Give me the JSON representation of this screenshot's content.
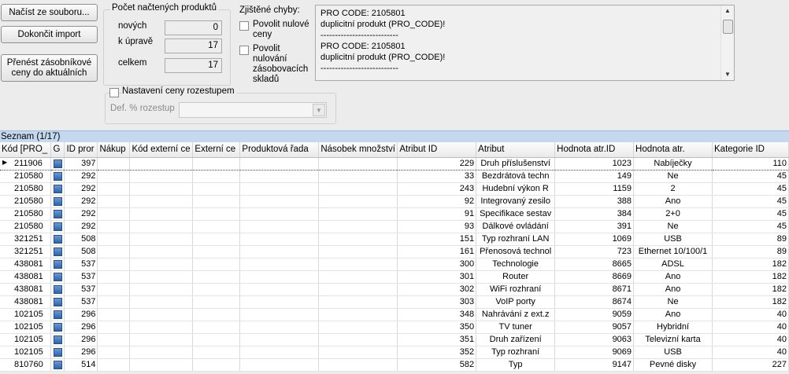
{
  "buttons": {
    "load": "Načíst ze souboru...",
    "finish": "Dokončit import",
    "transfer": "Přenést zásobníkové ceny do aktuálních"
  },
  "counts": {
    "title": "Počet načtených produktů",
    "new_label": "nových",
    "new_value": "0",
    "edit_label": "k úpravě",
    "edit_value": "17",
    "total_label": "celkem",
    "total_value": "17"
  },
  "errors": {
    "title": "Zjištěné chyby:",
    "allow_zero_prices": "Povolit nulové ceny",
    "allow_zero_stock": "Povolit nulování zásobovacích skladů",
    "text": "PRO CODE: 2105801\nduplicitní produkt (PRO_CODE)!\n---------------------------\nPRO CODE: 2105801\nduplicitní produkt (PRO_CODE)!\n---------------------------"
  },
  "step_pricing": {
    "label": "Nastavení ceny rozestupem",
    "def_label": "Def. % rozestup",
    "def_value": ""
  },
  "grid": {
    "title": "Seznam (1/17)",
    "columns": [
      "Kód [PRO_",
      "G",
      "ID pror",
      "Nákup",
      "Kód externí ce",
      "Externí ce",
      "Produktová řada",
      "Násobek množství",
      "Atribut ID",
      "Atribut",
      "Hodnota atr.ID",
      "Hodnota atr.",
      "Kategorie ID"
    ],
    "rows": [
      [
        "211906",
        "397",
        "",
        "",
        "",
        "",
        "",
        "229",
        "Druh příslušenství",
        "1023",
        "Nabíječky",
        "110"
      ],
      [
        "210580",
        "292",
        "",
        "",
        "",
        "",
        "",
        "33",
        "Bezdrátová techn",
        "149",
        "Ne",
        "45"
      ],
      [
        "210580",
        "292",
        "",
        "",
        "",
        "",
        "",
        "243",
        "Hudební výkon R",
        "1159",
        "2",
        "45"
      ],
      [
        "210580",
        "292",
        "",
        "",
        "",
        "",
        "",
        "92",
        "Integrovaný zesilo",
        "388",
        "Ano",
        "45"
      ],
      [
        "210580",
        "292",
        "",
        "",
        "",
        "",
        "",
        "91",
        "Specifikace sestav",
        "384",
        "2+0",
        "45"
      ],
      [
        "210580",
        "292",
        "",
        "",
        "",
        "",
        "",
        "93",
        "Dálkové ovládání",
        "391",
        "Ne",
        "45"
      ],
      [
        "321251",
        "508",
        "",
        "",
        "",
        "",
        "",
        "151",
        "Typ rozhraní LAN",
        "1069",
        "USB",
        "89"
      ],
      [
        "321251",
        "508",
        "",
        "",
        "",
        "",
        "",
        "161",
        "Přenosová technol",
        "723",
        "Ethernet 10/100/1",
        "89"
      ],
      [
        "438081",
        "537",
        "",
        "",
        "",
        "",
        "",
        "300",
        "Technologie",
        "8665",
        "ADSL",
        "182"
      ],
      [
        "438081",
        "537",
        "",
        "",
        "",
        "",
        "",
        "301",
        "Router",
        "8669",
        "Ano",
        "182"
      ],
      [
        "438081",
        "537",
        "",
        "",
        "",
        "",
        "",
        "302",
        "WiFi rozhraní",
        "8671",
        "Ano",
        "182"
      ],
      [
        "438081",
        "537",
        "",
        "",
        "",
        "",
        "",
        "303",
        "VoIP porty",
        "8674",
        "Ne",
        "182"
      ],
      [
        "102105",
        "296",
        "",
        "",
        "",
        "",
        "",
        "348",
        "Nahrávání z ext.z",
        "9059",
        "Ano",
        "40"
      ],
      [
        "102105",
        "296",
        "",
        "",
        "",
        "",
        "",
        "350",
        "TV tuner",
        "9057",
        "Hybridní",
        "40"
      ],
      [
        "102105",
        "296",
        "",
        "",
        "",
        "",
        "",
        "351",
        "Druh zařízení",
        "9063",
        "Televizní karta",
        "40"
      ],
      [
        "102105",
        "296",
        "",
        "",
        "",
        "",
        "",
        "352",
        "Typ rozhraní",
        "9069",
        "USB",
        "40"
      ],
      [
        "810760",
        "514",
        "",
        "",
        "",
        "",
        "",
        "582",
        "Typ",
        "9147",
        "Pevné disky",
        "227"
      ]
    ]
  }
}
